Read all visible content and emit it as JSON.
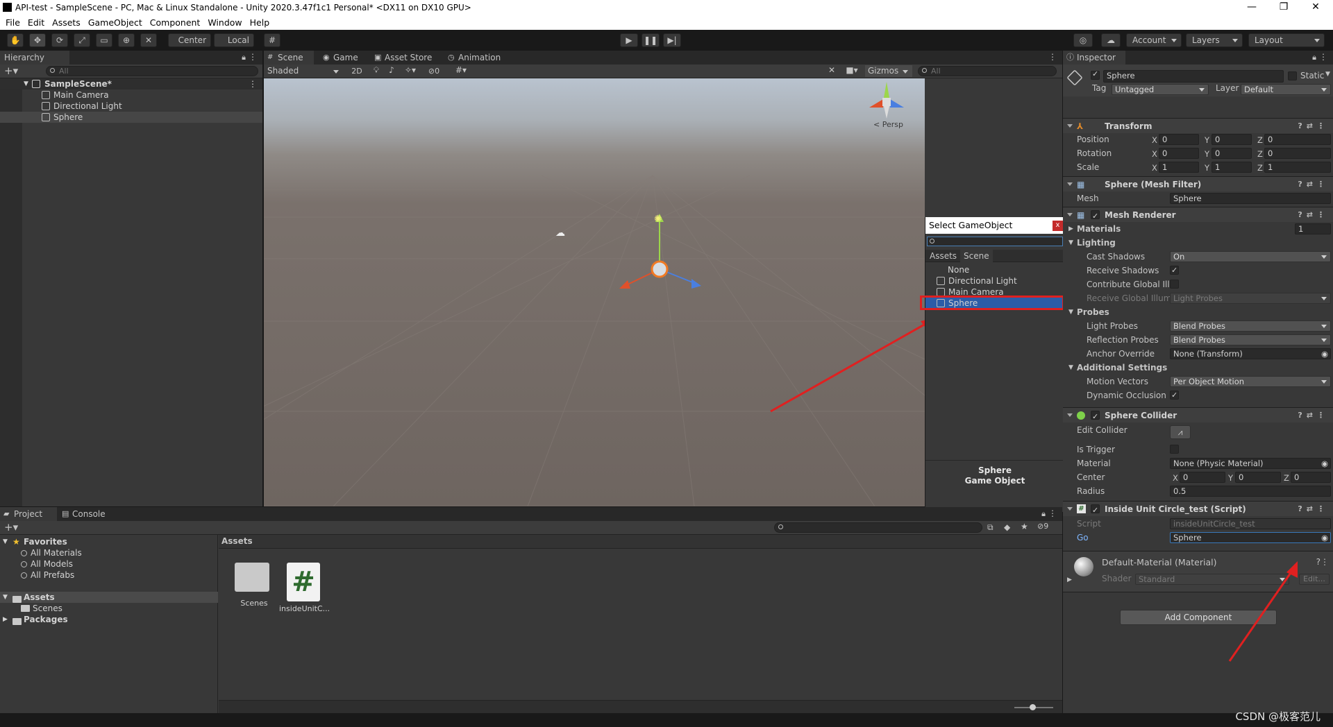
{
  "window": {
    "title": "API-test - SampleScene - PC, Mac & Linux Standalone - Unity 2020.3.47f1c1 Personal* <DX11 on DX10 GPU>",
    "minimize": "—",
    "restore": "❐",
    "close": "✕"
  },
  "menu": [
    "File",
    "Edit",
    "Assets",
    "GameObject",
    "Component",
    "Window",
    "Help"
  ],
  "toolbar": {
    "pivot": "Center",
    "space": "Local",
    "account": "Account",
    "layers": "Layers",
    "layout": "Layout"
  },
  "hierarchy": {
    "tab": "Hierarchy",
    "search_placeholder": "All",
    "scene": "SampleScene*",
    "items": [
      "Main Camera",
      "Directional Light",
      "Sphere"
    ]
  },
  "scene_tabs": [
    "Scene",
    "Game",
    "Asset Store",
    "Animation"
  ],
  "scene_toolbar": {
    "shading": "Shaded",
    "mode2d": "2D",
    "fx_count": "0",
    "gizmos": "Gizmos",
    "search_placeholder": "All",
    "persp": "Persp"
  },
  "select_popup": {
    "title": "Select GameObject",
    "close": "x",
    "tabs": [
      "Assets",
      "Scene"
    ],
    "items": [
      "None",
      "Directional Light",
      "Main Camera",
      "Sphere"
    ],
    "selected": "Sphere",
    "footer_name": "Sphere",
    "footer_type": "Game Object"
  },
  "inspector": {
    "tab": "Inspector",
    "object_name": "Sphere",
    "static_label": "Static",
    "tag_label": "Tag",
    "tag_value": "Untagged",
    "layer_label": "Layer",
    "layer_value": "Default",
    "transform": {
      "title": "Transform",
      "position_label": "Position",
      "rotation_label": "Rotation",
      "scale_label": "Scale",
      "position": [
        "0",
        "0",
        "0"
      ],
      "rotation": [
        "0",
        "0",
        "0"
      ],
      "scale": [
        "1",
        "1",
        "1"
      ]
    },
    "mesh_filter": {
      "title": "Sphere (Mesh Filter)",
      "mesh_label": "Mesh",
      "mesh_value": "Sphere"
    },
    "mesh_renderer": {
      "title": "Mesh Renderer",
      "materials_label": "Materials",
      "materials_count": "1",
      "lighting_label": "Lighting",
      "cast_shadows_label": "Cast Shadows",
      "cast_shadows_value": "On",
      "receive_shadows_label": "Receive Shadows",
      "contribute_gi_label": "Contribute Global Illui",
      "receive_gi_label": "Receive Global Illumi",
      "receive_gi_value": "Light Probes",
      "probes_label": "Probes",
      "light_probes_label": "Light Probes",
      "light_probes_value": "Blend Probes",
      "reflection_probes_label": "Reflection Probes",
      "reflection_probes_value": "Blend Probes",
      "anchor_override_label": "Anchor Override",
      "anchor_override_value": "None (Transform)",
      "additional_label": "Additional Settings",
      "motion_vectors_label": "Motion Vectors",
      "motion_vectors_value": "Per Object Motion",
      "dynamic_occlusion_label": "Dynamic Occlusion"
    },
    "sphere_collider": {
      "title": "Sphere Collider",
      "edit_collider_label": "Edit Collider",
      "is_trigger_label": "Is Trigger",
      "material_label": "Material",
      "material_value": "None (Physic Material)",
      "center_label": "Center",
      "center": [
        "0",
        "0",
        "0"
      ],
      "radius_label": "Radius",
      "radius": "0.5"
    },
    "script": {
      "title": "Inside Unit Circle_test (Script)",
      "script_label": "Script",
      "script_value": "insideUnitCircle_test",
      "go_label": "Go",
      "go_value": "Sphere"
    },
    "material": {
      "title": "Default-Material (Material)",
      "shader_label": "Shader",
      "shader_value": "Standard",
      "edit": "Edit..."
    },
    "add_component": "Add Component",
    "x": "X",
    "y": "Y",
    "z": "Z"
  },
  "project": {
    "tabs": [
      "Project",
      "Console"
    ],
    "favorites": "Favorites",
    "favorite_items": [
      "All Materials",
      "All Models",
      "All Prefabs"
    ],
    "assets": "Assets",
    "asset_children": [
      "Scenes"
    ],
    "packages": "Packages",
    "breadcrumb": "Assets",
    "files": [
      {
        "name": "Scenes",
        "kind": "folder"
      },
      {
        "name": "insideUnitC...",
        "kind": "script"
      }
    ],
    "hidden_count": "9"
  },
  "watermark": "CSDN @极客范儿",
  "colors": {
    "selection": "#2c5d87",
    "popup_selection": "#2c5ca7",
    "highlight_box": "#e02020",
    "arrow": "#e02020"
  }
}
